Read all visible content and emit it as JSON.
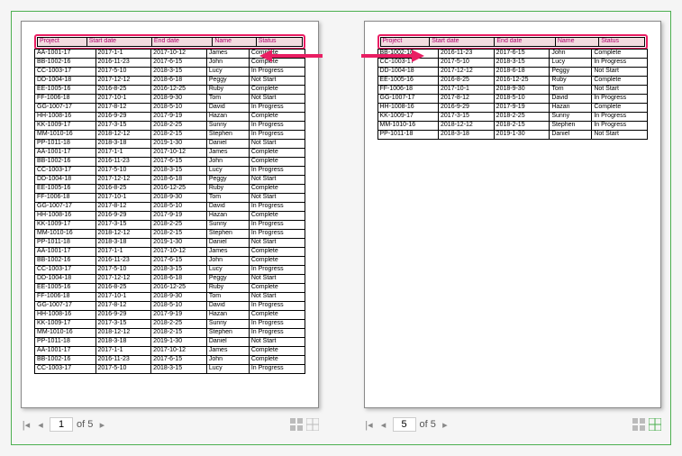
{
  "headers": [
    "Project",
    "Start date",
    "End date",
    "Name",
    "Status"
  ],
  "table_left": [
    [
      "AA-1001-17",
      "2017-1-1",
      "2017-10-12",
      "James",
      "Complete"
    ],
    [
      "BB-1002-16",
      "2016-11-23",
      "2017-6-15",
      "John",
      "Complete"
    ],
    [
      "CC-1003-17",
      "2017-5-10",
      "2018-3-15",
      "Lucy",
      "In Progress"
    ],
    [
      "DD-1004-18",
      "2017-12-12",
      "2018-6-18",
      "Peggy",
      "Not Start"
    ],
    [
      "EE-1005-16",
      "2016-8-25",
      "2016-12-25",
      "Ruby",
      "Complete"
    ],
    [
      "FF-1006-18",
      "2017-10-1",
      "2018-9-30",
      "Tom",
      "Not Start"
    ],
    [
      "GG-1007-17",
      "2017-8-12",
      "2018-5-10",
      "David",
      "In Progress"
    ],
    [
      "HH-1008-16",
      "2016-9-29",
      "2017-9-19",
      "Hazan",
      "Complete"
    ],
    [
      "KK-1009-17",
      "2017-3-15",
      "2018-2-25",
      "Sunny",
      "In Progress"
    ],
    [
      "MM-1010-16",
      "2018-12-12",
      "2018-2-15",
      "Stephen",
      "In Progress"
    ],
    [
      "PP-1011-18",
      "2018-3-18",
      "2019-1-30",
      "Daniel",
      "Not Start"
    ],
    [
      "AA-1001-17",
      "2017-1-1",
      "2017-10-12",
      "James",
      "Complete"
    ],
    [
      "BB-1002-16",
      "2016-11-23",
      "2017-6-15",
      "John",
      "Complete"
    ],
    [
      "CC-1003-17",
      "2017-5-10",
      "2018-3-15",
      "Lucy",
      "In Progress"
    ],
    [
      "DD-1004-18",
      "2017-12-12",
      "2018-6-18",
      "Peggy",
      "Not Start"
    ],
    [
      "EE-1005-16",
      "2016-8-25",
      "2016-12-25",
      "Ruby",
      "Complete"
    ],
    [
      "FF-1006-18",
      "2017-10-1",
      "2018-9-30",
      "Tom",
      "Not Start"
    ],
    [
      "GG-1007-17",
      "2017-8-12",
      "2018-5-10",
      "David",
      "In Progress"
    ],
    [
      "HH-1008-16",
      "2016-9-29",
      "2017-9-19",
      "Hazan",
      "Complete"
    ],
    [
      "KK-1009-17",
      "2017-3-15",
      "2018-2-25",
      "Sunny",
      "In Progress"
    ],
    [
      "MM-1010-16",
      "2018-12-12",
      "2018-2-15",
      "Stephen",
      "In Progress"
    ],
    [
      "PP-1011-18",
      "2018-3-18",
      "2019-1-30",
      "Daniel",
      "Not Start"
    ],
    [
      "AA-1001-17",
      "2017-1-1",
      "2017-10-12",
      "James",
      "Complete"
    ],
    [
      "BB-1002-16",
      "2016-11-23",
      "2017-6-15",
      "John",
      "Complete"
    ],
    [
      "CC-1003-17",
      "2017-5-10",
      "2018-3-15",
      "Lucy",
      "In Progress"
    ],
    [
      "DD-1004-18",
      "2017-12-12",
      "2018-6-18",
      "Peggy",
      "Not Start"
    ],
    [
      "EE-1005-16",
      "2016-8-25",
      "2016-12-25",
      "Ruby",
      "Complete"
    ],
    [
      "FF-1006-18",
      "2017-10-1",
      "2018-9-30",
      "Tom",
      "Not Start"
    ],
    [
      "GG-1007-17",
      "2017-8-12",
      "2018-5-10",
      "David",
      "In Progress"
    ],
    [
      "HH-1008-16",
      "2016-9-29",
      "2017-9-19",
      "Hazan",
      "Complete"
    ],
    [
      "KK-1009-17",
      "2017-3-15",
      "2018-2-25",
      "Sunny",
      "In Progress"
    ],
    [
      "MM-1010-16",
      "2018-12-12",
      "2018-2-15",
      "Stephen",
      "In Progress"
    ],
    [
      "PP-1011-18",
      "2018-3-18",
      "2019-1-30",
      "Daniel",
      "Not Start"
    ],
    [
      "AA-1001-17",
      "2017-1-1",
      "2017-10-12",
      "James",
      "Complete"
    ],
    [
      "BB-1002-16",
      "2016-11-23",
      "2017-6-15",
      "John",
      "Complete"
    ],
    [
      "CC-1003-17",
      "2017-5-10",
      "2018-3-15",
      "Lucy",
      "In Progress"
    ]
  ],
  "table_right": [
    [
      "BB-1002-16",
      "2016-11-23",
      "2017-6-15",
      "John",
      "Complete"
    ],
    [
      "CC-1003-17",
      "2017-5-10",
      "2018-3-15",
      "Lucy",
      "In Progress"
    ],
    [
      "DD-1004-18",
      "2017-12-12",
      "2018-6-18",
      "Peggy",
      "Not Start"
    ],
    [
      "EE-1005-16",
      "2016-8-25",
      "2016-12-25",
      "Ruby",
      "Complete"
    ],
    [
      "FF-1006-18",
      "2017-10-1",
      "2018-9-30",
      "Tom",
      "Not Start"
    ],
    [
      "GG-1007-17",
      "2017-8-12",
      "2018-5-10",
      "David",
      "In Progress"
    ],
    [
      "HH-1008-16",
      "2016-9-29",
      "2017-9-19",
      "Hazan",
      "Complete"
    ],
    [
      "KK-1009-17",
      "2017-3-15",
      "2018-2-25",
      "Sunny",
      "In Progress"
    ],
    [
      "MM-1010-16",
      "2018-12-12",
      "2018-2-15",
      "Stephen",
      "In Progress"
    ],
    [
      "PP-1011-18",
      "2018-3-18",
      "2019-1-30",
      "Daniel",
      "Not Start"
    ]
  ],
  "pager_left": {
    "current": "1",
    "total_label": "of 5"
  },
  "pager_right": {
    "current": "5",
    "total_label": "of 5"
  }
}
